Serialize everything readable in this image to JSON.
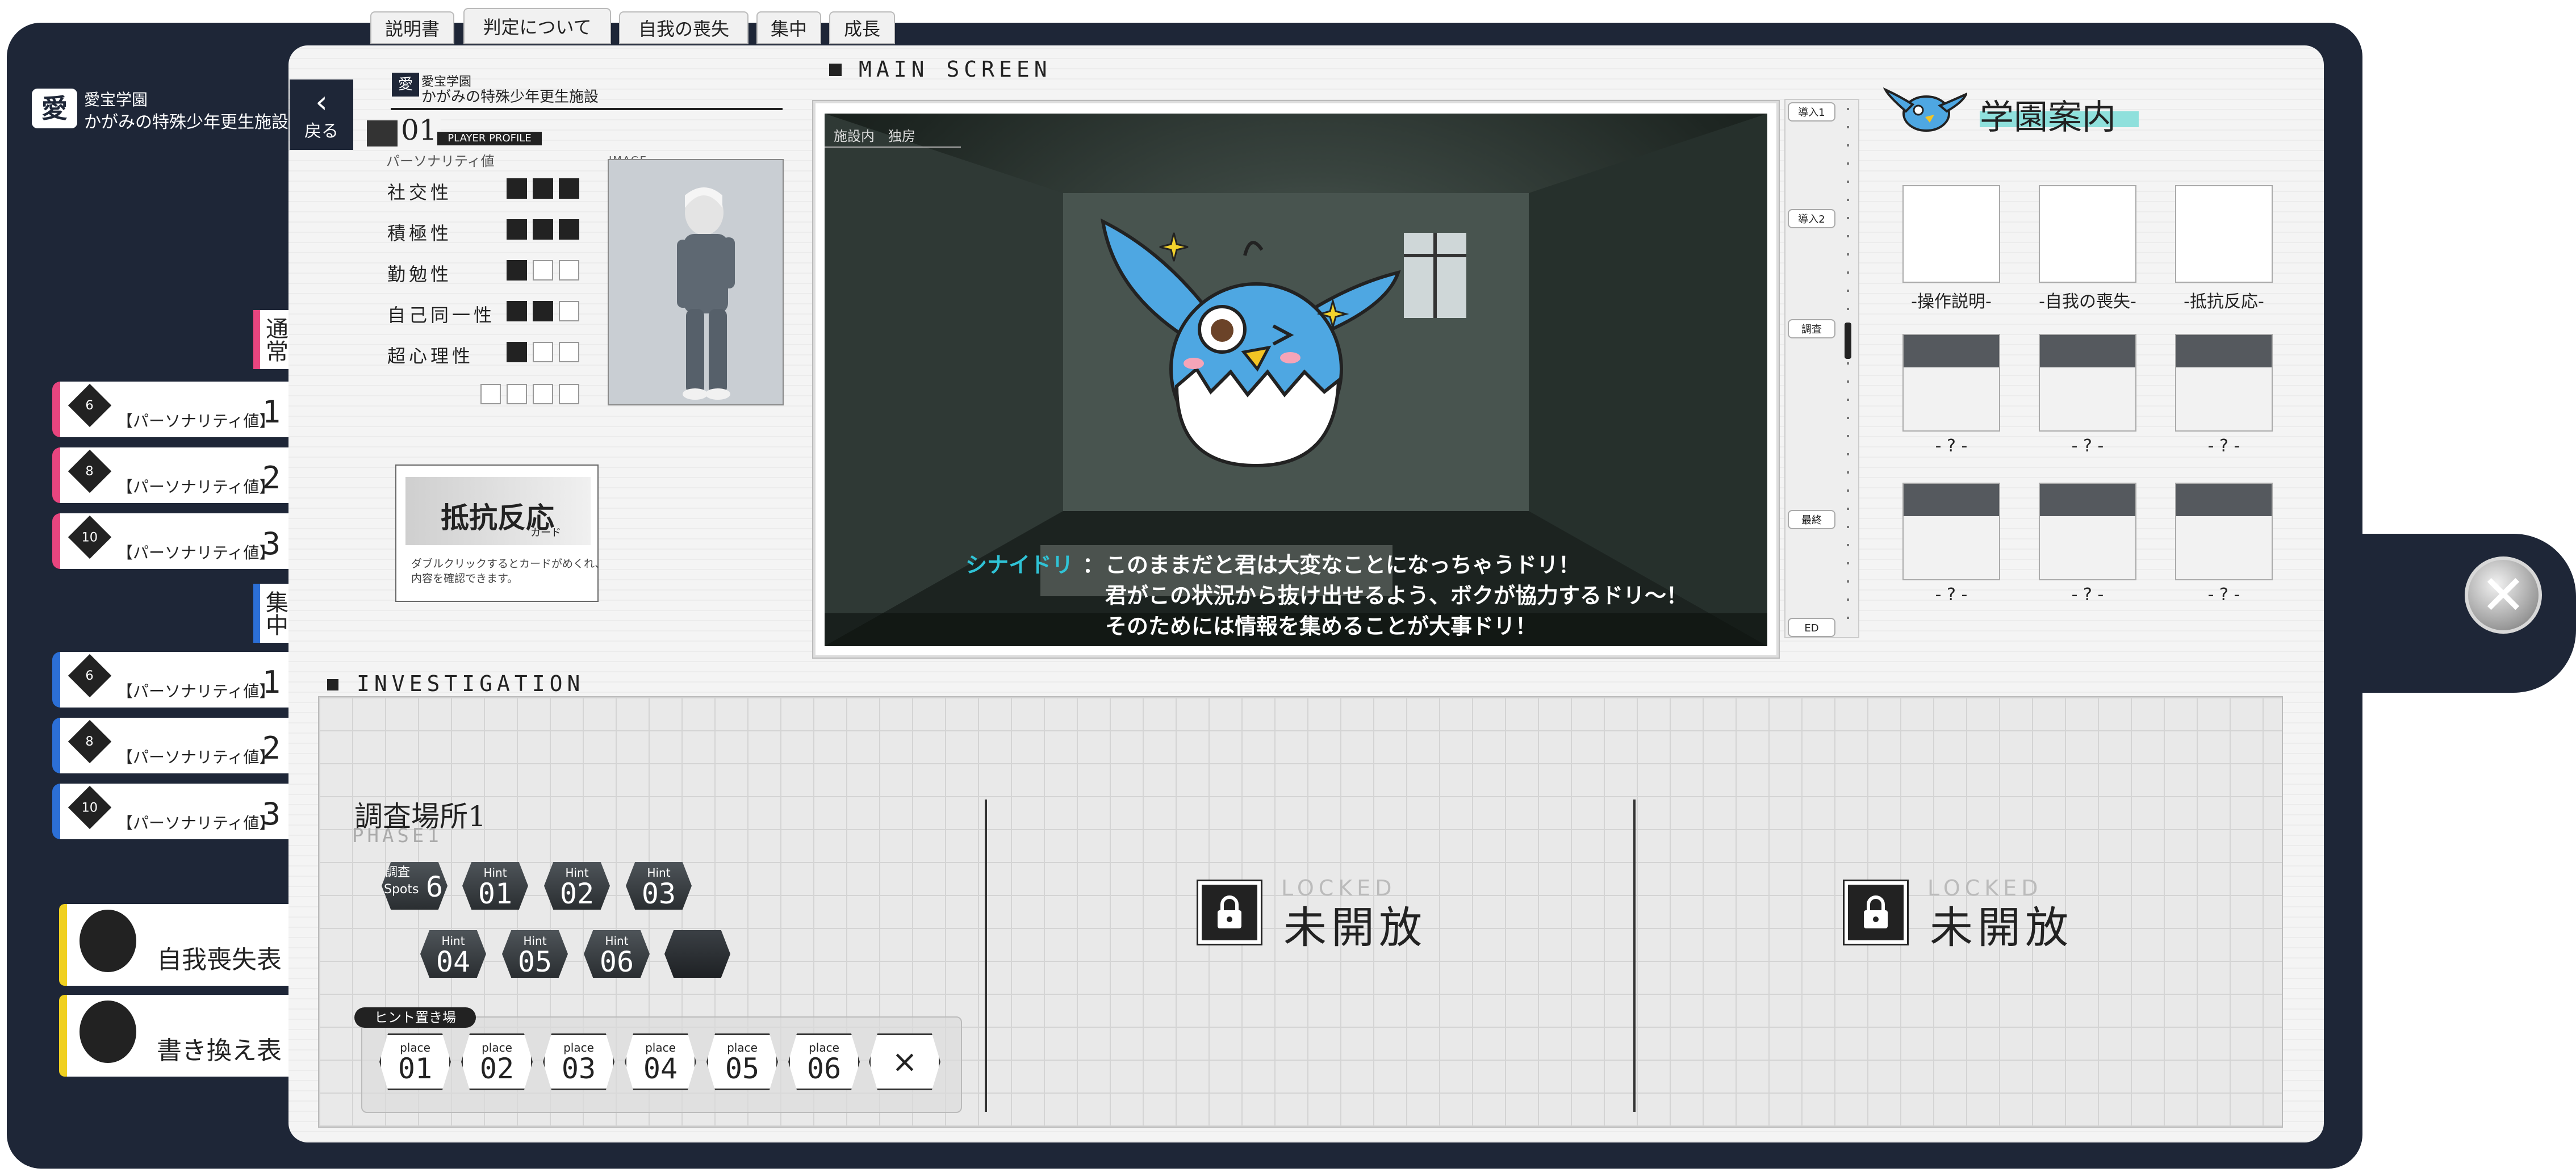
{
  "logo": {
    "emblem": "愛",
    "line1": "愛宝学園",
    "line2": "かがみの特殊少年更生施設"
  },
  "header_tabs": [
    "説明書",
    "判定について",
    "自我の喪失",
    "集中",
    "成長"
  ],
  "side": {
    "normal_heading": "通常",
    "focus_heading": "集中",
    "normal_items": [
      {
        "dice": "6",
        "label": "【パーソナリティ値】",
        "num": "1"
      },
      {
        "dice": "8",
        "label": "【パーソナリティ値】",
        "num": "2"
      },
      {
        "dice": "10",
        "label": "【パーソナリティ値】",
        "num": "3"
      }
    ],
    "focus_items": [
      {
        "dice": "6",
        "label": "【パーソナリティ値】",
        "num": "1"
      },
      {
        "dice": "8",
        "label": "【パーソナリティ値】",
        "num": "2"
      },
      {
        "dice": "10",
        "label": "【パーソナリティ値】",
        "num": "3"
      }
    ],
    "ego_table": "自我喪失表",
    "rewrite_table": "書き換え表"
  },
  "profile": {
    "back_label": "戻る",
    "school_line1": "愛宝学園",
    "school_line2": "かがみの特殊少年更生施設",
    "number": "01",
    "profile_label": "PLAYER PROFILE",
    "personality_label": "パーソナリティ値",
    "image_label": "IMAGE",
    "stats": [
      {
        "name": "社交性",
        "value": 3
      },
      {
        "name": "積極性",
        "value": 3
      },
      {
        "name": "勤勉性",
        "value": 1
      },
      {
        "name": "自己同一性",
        "value": 2
      },
      {
        "name": "超心理性",
        "value": 1
      }
    ],
    "card": {
      "title": "抵抗反応",
      "sub": "カード",
      "desc1": "ダブルクリックするとカードがめくれ、",
      "desc2": "内容を確認できます。"
    }
  },
  "main_screen": {
    "title": "MAIN SCREEN",
    "location": "施設内　独房",
    "speaker": "シナイドリ",
    "lines": [
      "このままだと君は大変なことになっちゃうドリ！",
      "君がこの状況から抜け出せるよう、ボクが協力するドリ〜！",
      "そのためには情報を集めることが大事ドリ！"
    ],
    "chapters": [
      "導入1",
      "導入2",
      "調査",
      "最終",
      "ED"
    ]
  },
  "guide": {
    "title": "学園案内",
    "items": [
      "-操作説明-",
      "-自我の喪失-",
      "-抵抗反応-",
      "- ? -",
      "- ? -",
      "- ? -",
      "- ? -",
      "- ? -",
      "- ? -"
    ]
  },
  "investigation": {
    "title": "INVESTIGATION",
    "location_title": "調査場所1",
    "phase": "PHASE1",
    "spots_label1": "調査",
    "spots_label2": "Spots",
    "spots_count": "6",
    "hint_label": "Hint",
    "hints_row1": [
      "01",
      "02",
      "03"
    ],
    "hints_row2": [
      "04",
      "05",
      "06"
    ],
    "hint_board_label": "ヒント置き場",
    "place_label": "place",
    "places": [
      "01",
      "02",
      "03",
      "04",
      "05",
      "06"
    ],
    "clear_symbol": "×",
    "locked_en": "LOCKED",
    "locked_jp": "未開放"
  },
  "colors": {
    "binder": "#1e2637",
    "pink": "#e8457f",
    "blue": "#2c6fd6",
    "yellow": "#f0d020",
    "bird": "#4ea7e2",
    "cyan": "#2fc3d6"
  }
}
